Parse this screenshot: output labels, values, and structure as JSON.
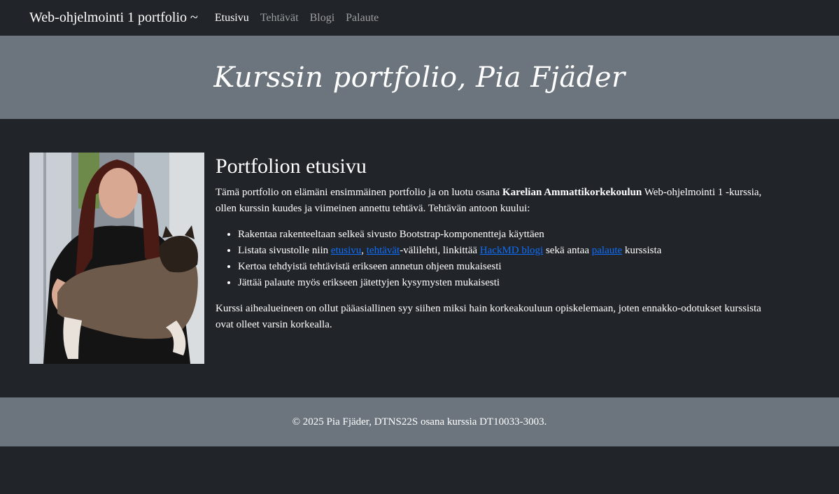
{
  "navbar": {
    "brand": "Web-ohjelmointi 1 portfolio ~",
    "links": [
      {
        "label": "Etusivu",
        "active": true
      },
      {
        "label": "Tehtävät",
        "active": false
      },
      {
        "label": "Blogi",
        "active": false
      },
      {
        "label": "Palaute",
        "active": false
      }
    ]
  },
  "hero": {
    "title": "Kurssin portfolio, Pia Fjäder"
  },
  "main": {
    "heading": "Portfolion etusivu",
    "intro": {
      "before": "Tämä portfolio on elämäni ensimmäinen portfolio ja on luotu osana ",
      "bold": "Karelian Ammattikorkekoulun",
      "after": " Web-ohjelmointi 1 -kurssia, ollen kurssin kuudes ja viimeinen annettu tehtävä. Tehtävän antoon kuului:"
    },
    "list": {
      "item1": "Rakentaa rakenteeltaan selkeä sivusto Bootstrap-komponentteja käyttäen",
      "item2": {
        "t1": "Listata sivustolle niin ",
        "link1": "etusivu",
        "t2": ", ",
        "link2": "tehtävät",
        "t3": "-välilehti, linkittää ",
        "link3": "HackMD blogi",
        "t4": " sekä antaa ",
        "link4": "palaute",
        "t5": " kurssista"
      },
      "item3": "Kertoa tehdyistä tehtävistä erikseen annetun ohjeen mukaisesti",
      "item4": "Jättää palaute myös erikseen jätettyjen kysymysten mukaisesti"
    },
    "outro": "Kurssi aihealueineen on ollut pääasiallinen syy siihen miksi hain korkeakouluun opiskelemaan, joten ennakko-odotukset kurssista ovat olleet varsin korkealla."
  },
  "footer": {
    "text": "© 2025 Pia Fjäder, DTNS22S osana kurssia DT10033-3003."
  },
  "colors": {
    "background": "#212529",
    "band": "#6c757d",
    "link": "#0d6efd"
  }
}
